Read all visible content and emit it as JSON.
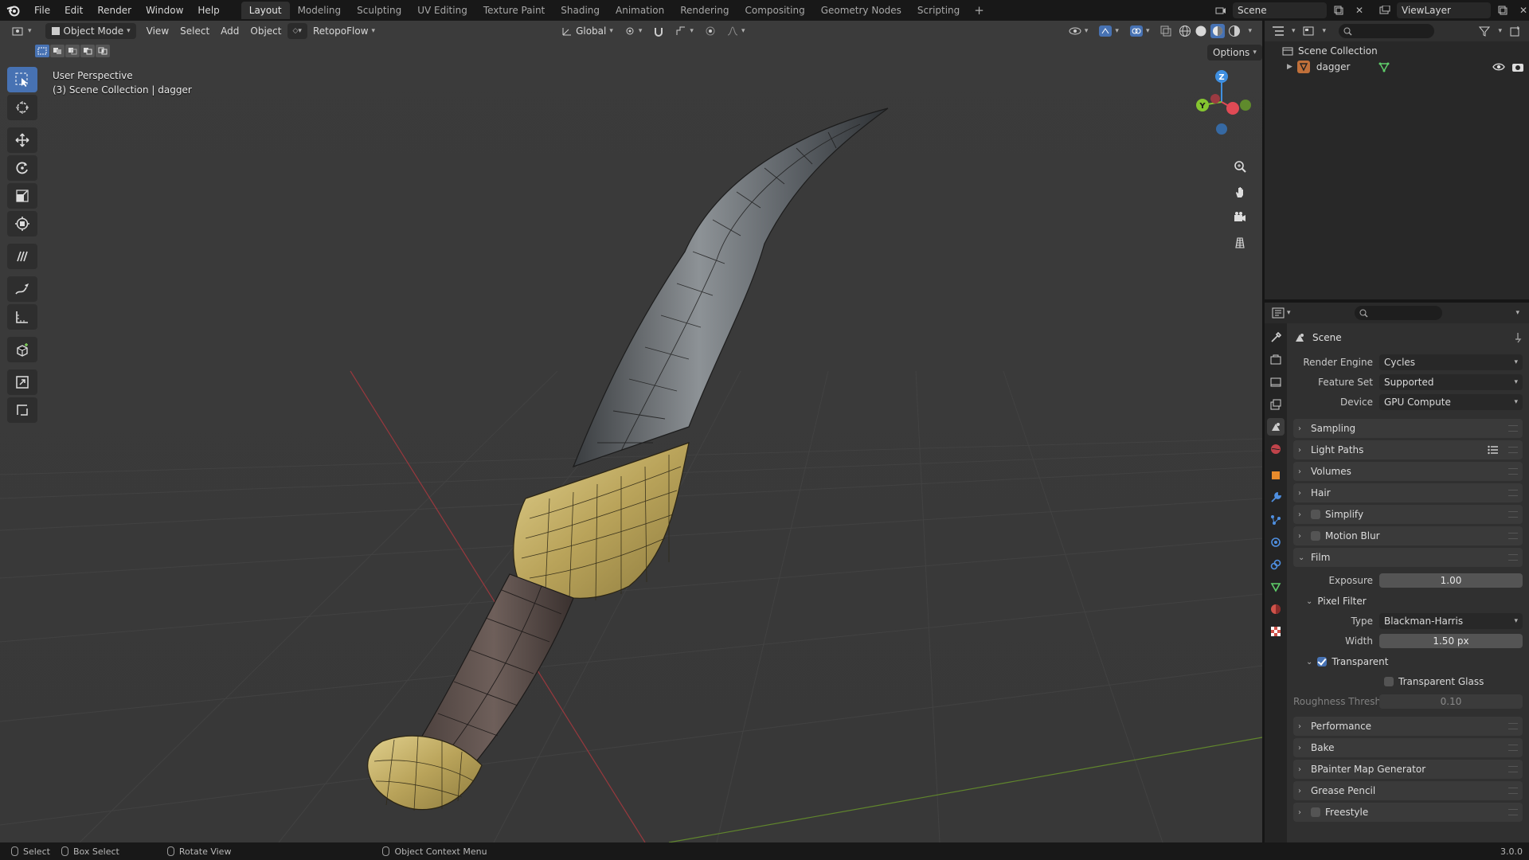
{
  "menubar": {
    "items": [
      "File",
      "Edit",
      "Render",
      "Window",
      "Help"
    ],
    "workspaces": [
      "Layout",
      "Modeling",
      "Sculpting",
      "UV Editing",
      "Texture Paint",
      "Shading",
      "Animation",
      "Rendering",
      "Compositing",
      "Geometry Nodes",
      "Scripting"
    ],
    "active_workspace": "Layout",
    "add_tab": "+",
    "scene": "Scene",
    "view_layer": "ViewLayer"
  },
  "viewport": {
    "mode": "Object Mode",
    "menus": [
      "View",
      "Select",
      "Add",
      "Object"
    ],
    "addon": "RetopoFlow",
    "orientation": "Global",
    "options": "Options",
    "overlay_line1": "User Perspective",
    "overlay_line2": "(3) Scene Collection | dagger",
    "gizmo_axes": {
      "z": "Z",
      "y": "Y"
    },
    "tools": [
      "select-box",
      "cursor",
      "move",
      "rotate",
      "scale",
      "transform",
      "annotate",
      "annotate-line",
      "measure",
      "add-cube",
      "shrink",
      "extrude"
    ]
  },
  "outliner": {
    "collection": "Scene Collection",
    "object": "dagger"
  },
  "properties": {
    "context": "Scene",
    "render_engine_label": "Render Engine",
    "render_engine": "Cycles",
    "feature_set_label": "Feature Set",
    "feature_set": "Supported",
    "device_label": "Device",
    "device": "GPU Compute",
    "panels_top": [
      "Sampling",
      "Light Paths",
      "Volumes",
      "Hair",
      "Simplify",
      "Motion Blur"
    ],
    "film": {
      "label": "Film",
      "exposure_label": "Exposure",
      "exposure": "1.00",
      "pixel_filter_label": "Pixel Filter",
      "type_label": "Type",
      "type": "Blackman-Harris",
      "width_label": "Width",
      "width": "1.50 px",
      "transparent_label": "Transparent",
      "transparent_glass_label": "Transparent Glass",
      "roughness_label": "Roughness Threshold",
      "roughness": "0.10"
    },
    "panels_bottom": [
      "Performance",
      "Bake",
      "BPainter Map Generator",
      "Grease Pencil",
      "Freestyle"
    ]
  },
  "statusbar": {
    "select": "Select",
    "box_select": "Box Select",
    "rotate_view": "Rotate View",
    "context_menu": "Object Context Menu",
    "version": "3.0.0"
  },
  "colors": {
    "accent": "#4772b3",
    "x_axis": "#e04a55",
    "y_axis": "#85c530",
    "z_axis": "#3f8fe0",
    "gold": "#c9b46c",
    "blade": "#6f7478"
  }
}
